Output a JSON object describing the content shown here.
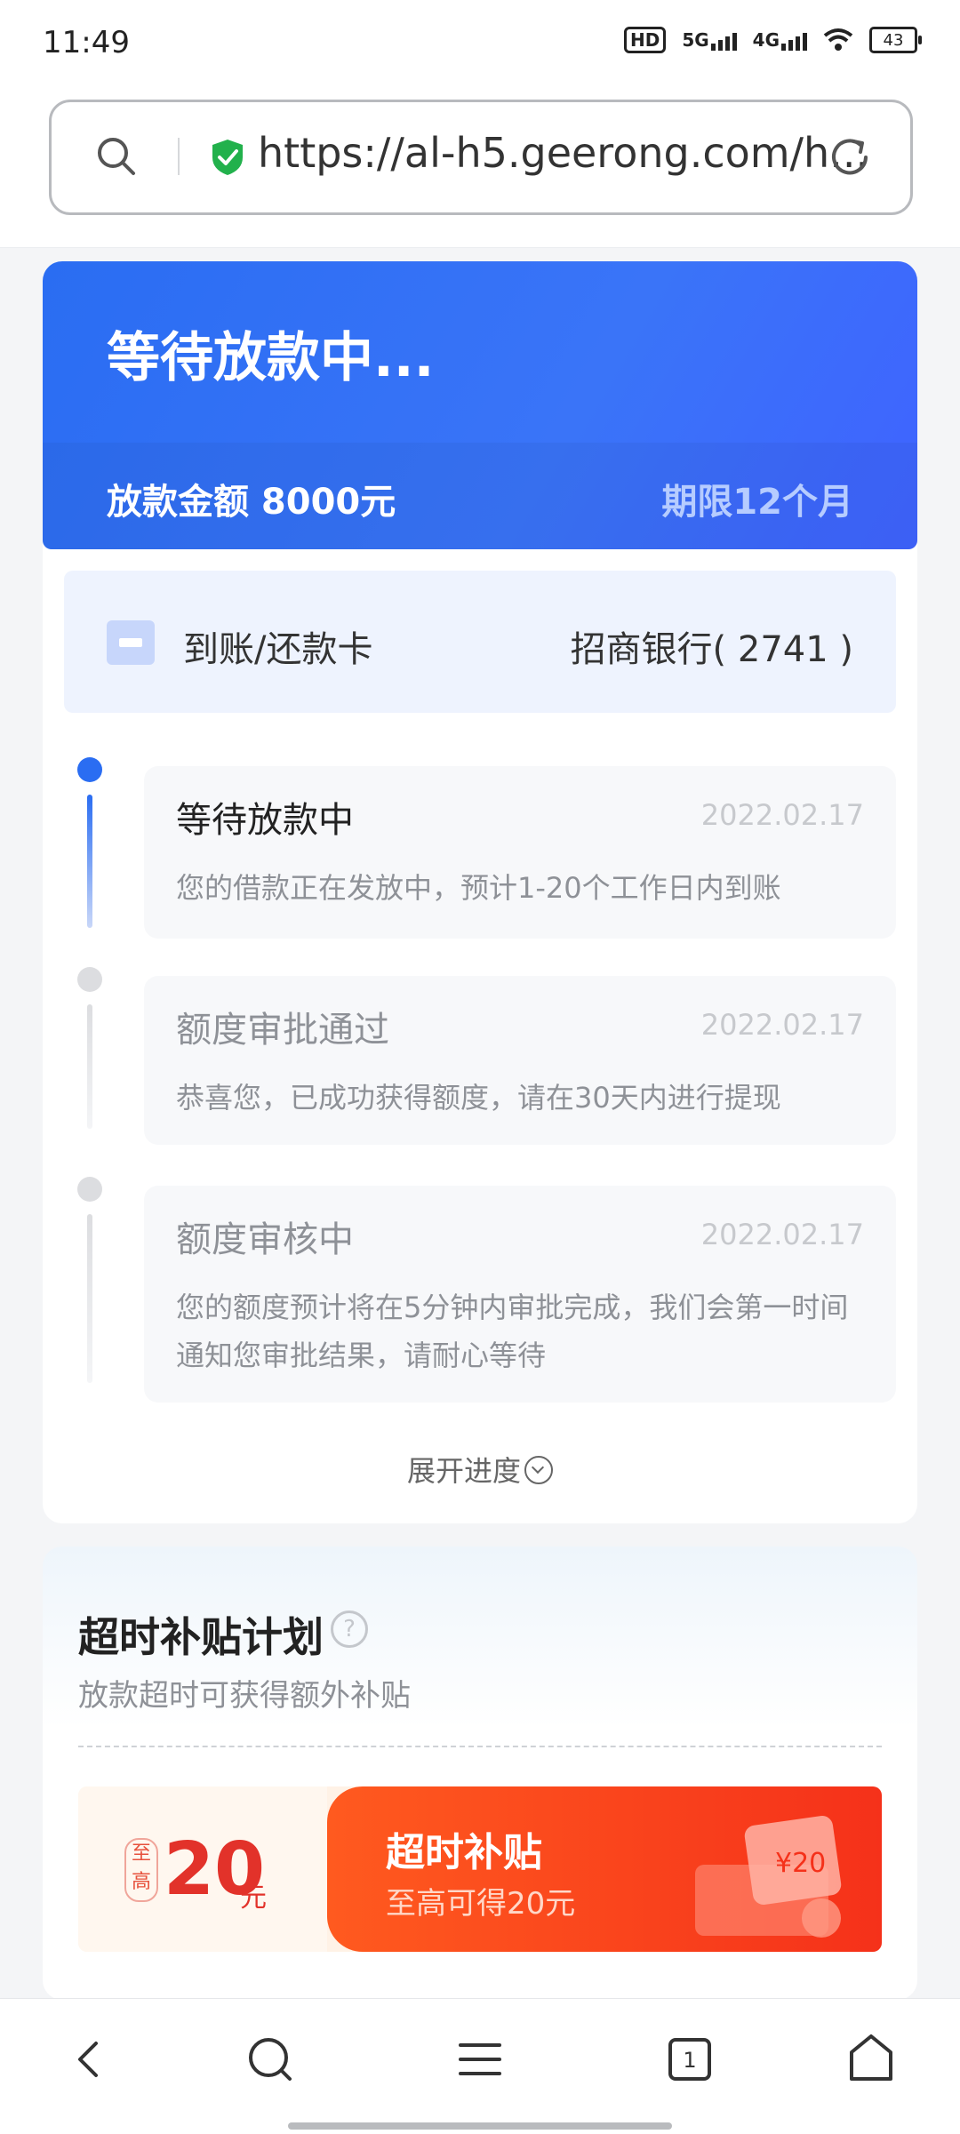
{
  "status_bar": {
    "time": "11:49",
    "hd_label": "HD",
    "net1": "5G",
    "net2": "4G",
    "battery": "43"
  },
  "browser": {
    "url": "https://al-h5.geerong.com/h..."
  },
  "loan_status": {
    "title": "等待放款中...",
    "amount_text": "放款金额 8000元",
    "term_text": "期限12个月"
  },
  "bank_card": {
    "label": "到账/还款卡",
    "bank": "招商银行( 2741 )"
  },
  "timeline": [
    {
      "title": "等待放款中",
      "date": "2022.02.17",
      "desc": "您的借款正在发放中，预计1-20个工作日内到账",
      "active": true
    },
    {
      "title": "额度审批通过",
      "date": "2022.02.17",
      "desc": "恭喜您，已成功获得额度，请在30天内进行提现",
      "active": false
    },
    {
      "title": "额度审核中",
      "date": "2022.02.17",
      "desc": "您的额度预计将在5分钟内审批完成，我们会第一时间通知您审批结果，请耐心等待",
      "active": false
    }
  ],
  "expand_label": "展开进度",
  "subsidy": {
    "title": "超时补贴计划",
    "help_icon": "?",
    "subtitle": "放款超时可获得额外补贴",
    "coupon": {
      "badge": "至高",
      "amount": "20",
      "unit": "元",
      "title": "超时补贴",
      "subtitle": "至高可得20元",
      "art_text": "¥20"
    }
  },
  "colors": {
    "primary": "#2a6df2",
    "coupon_red": "#f5311a",
    "active_dot": "#2a6df2",
    "inactive_dot": "#dcdde0"
  },
  "icons": [
    "search-icon",
    "shield-check-icon",
    "refresh-icon",
    "card-icon",
    "help-icon",
    "chevron-down-icon",
    "back-icon",
    "search-icon",
    "menu-icon",
    "tabs-icon",
    "home-icon"
  ],
  "bottom_nav": {
    "tabs_count": "1"
  }
}
